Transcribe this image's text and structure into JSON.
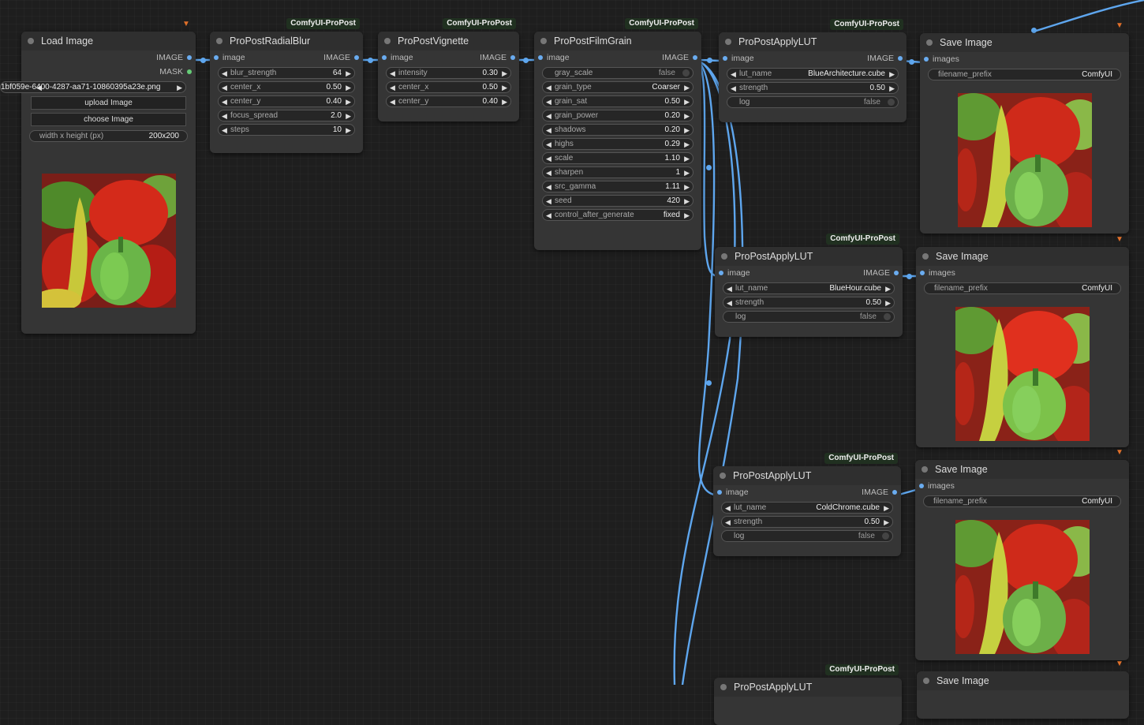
{
  "colors": {
    "link": "#5ea6ee",
    "badge_bg": "#203020",
    "node_bg": "#353535",
    "canvas_bg": "#1e1e1e"
  },
  "badge_text": "ComfyUI-ProPost",
  "load_image": {
    "title": "Load Image",
    "out_image": "IMAGE",
    "out_mask": "MASK",
    "filename": "1bf059e-6400-4287-aa71-10860395a23e.png",
    "upload_label": "upload Image",
    "choose_label": "choose Image",
    "size_label": "width x height (px)",
    "size_value": "200x200"
  },
  "radial_blur": {
    "title": "ProPostRadialBlur",
    "in": "image",
    "out": "IMAGE",
    "widgets": [
      {
        "label": "blur_strength",
        "value": "64"
      },
      {
        "label": "center_x",
        "value": "0.50"
      },
      {
        "label": "center_y",
        "value": "0.40"
      },
      {
        "label": "focus_spread",
        "value": "2.0"
      },
      {
        "label": "steps",
        "value": "10"
      }
    ]
  },
  "vignette": {
    "title": "ProPostVignette",
    "in": "image",
    "out": "IMAGE",
    "widgets": [
      {
        "label": "intensity",
        "value": "0.30"
      },
      {
        "label": "center_x",
        "value": "0.50"
      },
      {
        "label": "center_y",
        "value": "0.40"
      }
    ]
  },
  "film_grain": {
    "title": "ProPostFilmGrain",
    "in": "image",
    "out": "IMAGE",
    "toggle": {
      "label": "gray_scale",
      "value": "false"
    },
    "widgets": [
      {
        "label": "grain_type",
        "value": "Coarser"
      },
      {
        "label": "grain_sat",
        "value": "0.50"
      },
      {
        "label": "grain_power",
        "value": "0.20"
      },
      {
        "label": "shadows",
        "value": "0.20"
      },
      {
        "label": "highs",
        "value": "0.29"
      },
      {
        "label": "scale",
        "value": "1.10"
      },
      {
        "label": "sharpen",
        "value": "1"
      },
      {
        "label": "src_gamma",
        "value": "1.11"
      },
      {
        "label": "seed",
        "value": "420"
      },
      {
        "label": "control_after_generate",
        "value": "fixed"
      }
    ]
  },
  "luts": [
    {
      "title": "ProPostApplyLUT",
      "in": "image",
      "out": "IMAGE",
      "lut_label": "lut_name",
      "lut": "BlueArchitecture.cube",
      "strength_label": "strength",
      "strength": "0.50",
      "log_label": "log",
      "log": "false"
    },
    {
      "title": "ProPostApplyLUT",
      "in": "image",
      "out": "IMAGE",
      "lut_label": "lut_name",
      "lut": "BlueHour.cube",
      "strength_label": "strength",
      "strength": "0.50",
      "log_label": "log",
      "log": "false"
    },
    {
      "title": "ProPostApplyLUT",
      "in": "image",
      "out": "IMAGE",
      "lut_label": "lut_name",
      "lut": "ColdChrome.cube",
      "strength_label": "strength",
      "strength": "0.50",
      "log_label": "log",
      "log": "false"
    },
    {
      "title": "ProPostApplyLUT"
    }
  ],
  "saves": [
    {
      "title": "Save Image",
      "in": "images",
      "prefix_label": "filename_prefix",
      "prefix": "ComfyUI"
    },
    {
      "title": "Save Image",
      "in": "images",
      "prefix_label": "filename_prefix",
      "prefix": "ComfyUI"
    },
    {
      "title": "Save Image",
      "in": "images",
      "prefix_label": "filename_prefix",
      "prefix": "ComfyUI"
    },
    {
      "title": "Save Image"
    }
  ]
}
